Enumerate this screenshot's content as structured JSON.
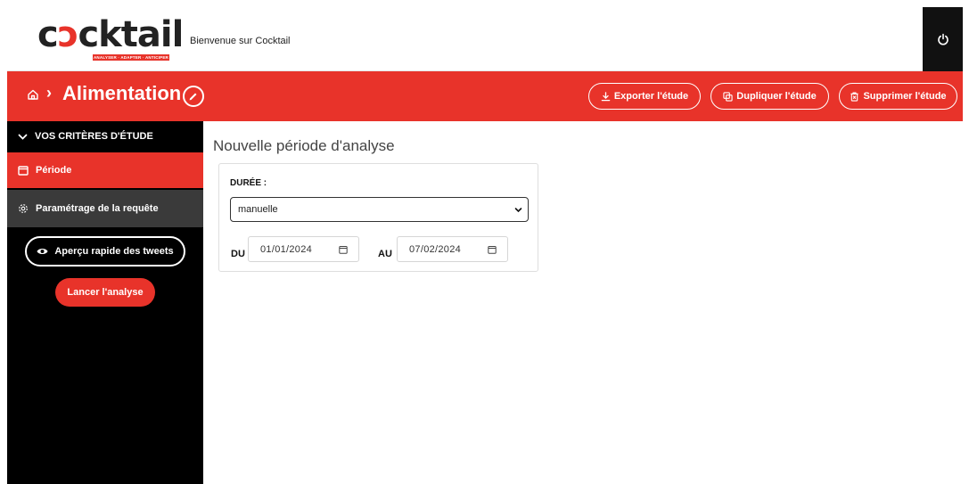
{
  "header": {
    "logo_text": "cocktail",
    "logo_tagline": "ANALYSER · ADAPTER · ANTICIPER",
    "welcome": "Bienvenue sur Cocktail",
    "power_icon": "power-icon"
  },
  "study_bar": {
    "title": "Alimentation",
    "separator": "›",
    "actions": {
      "export": "Exporter l'étude",
      "duplicate": "Dupliquer l'étude",
      "delete": "Supprimer l'étude"
    },
    "color": "#e8332a"
  },
  "sidebar": {
    "section_title": "VOS CRITÈRES D'ÉTUDE",
    "items": [
      {
        "label": "Période",
        "icon": "calendar-icon",
        "active": true
      },
      {
        "label": "Paramétrage de la requête",
        "icon": "gear-icon",
        "active": false
      }
    ],
    "tweets_button": "Aperçu rapide des tweets",
    "launch_button": "Lancer l'analyse"
  },
  "main": {
    "title": "Nouvelle période d'analyse",
    "duration_label": "DURÉE :",
    "duration_value": "manuelle",
    "from_label": "DU",
    "from_value": "01/01/2024",
    "to_label": "AU",
    "to_value": "07/02/2024"
  }
}
